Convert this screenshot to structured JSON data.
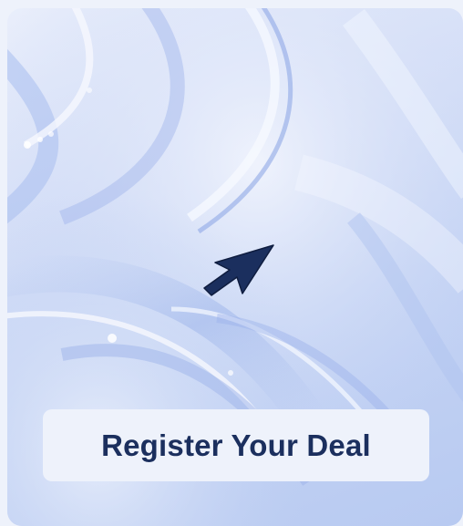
{
  "card": {
    "cta_label": "Register Your Deal"
  },
  "icons": {
    "cursor": "arrow-cursor-icon"
  },
  "colors": {
    "accent": "#1b2f5e",
    "button_bg": "#eef2fb",
    "image_tint": "#c4d3f4"
  }
}
